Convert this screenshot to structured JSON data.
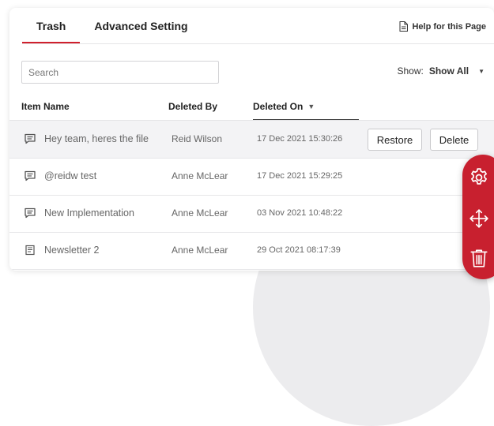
{
  "tabs": [
    {
      "label": "Trash",
      "active": true
    },
    {
      "label": "Advanced Setting",
      "active": false
    }
  ],
  "help": {
    "label": "Help for this Page",
    "icon": "document-icon"
  },
  "search": {
    "placeholder": "Search",
    "value": ""
  },
  "show": {
    "label": "Show:",
    "value": "Show All",
    "caret": "▼"
  },
  "columns": {
    "item_name": "Item Name",
    "deleted_by": "Deleted By",
    "deleted_on": "Deleted On",
    "sort_indicator": "▼"
  },
  "rows": [
    {
      "icon": "comment-icon",
      "name": "Hey team, heres the file",
      "deleted_by": "Reid Wilson",
      "deleted_on": "17 Dec 2021 15:30:26"
    },
    {
      "icon": "comment-icon",
      "name": "@reidw test",
      "deleted_by": "Anne McLear",
      "deleted_on": "17 Dec 2021 15:29:25"
    },
    {
      "icon": "comment-icon",
      "name": "New Implementation",
      "deleted_by": "Anne McLear",
      "deleted_on": "03 Nov 2021 10:48:22"
    },
    {
      "icon": "newsletter-icon",
      "name": "Newsletter 2",
      "deleted_by": "Anne McLear",
      "deleted_on": "29 Oct 2021 08:17:39"
    }
  ],
  "row_actions": {
    "restore": "Restore",
    "delete": "Delete"
  },
  "toolbar": {
    "icons": [
      "gear-icon",
      "move-icon",
      "trash-icon"
    ]
  },
  "colors": {
    "accent": "#c8202f",
    "tab_underline": "#d0202d"
  }
}
